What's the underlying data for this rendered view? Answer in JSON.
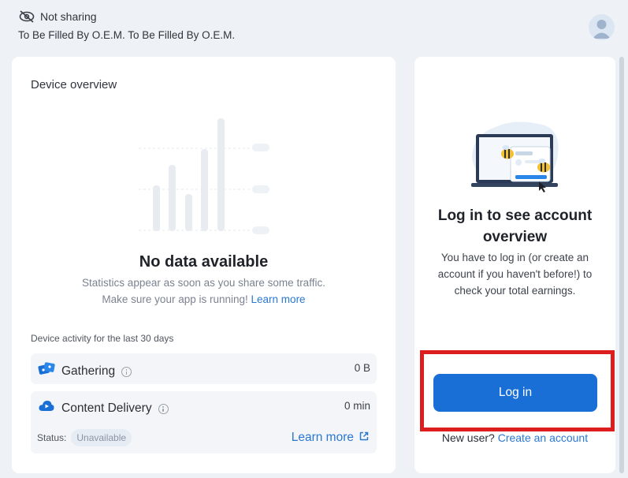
{
  "header": {
    "sharing_status": "Not sharing",
    "device_name": "To Be Filled By O.E.M. To Be Filled By O.E.M."
  },
  "overview": {
    "title": "Device overview",
    "no_data_title": "No data available",
    "no_data_line1": "Statistics appear as soon as you share some traffic.",
    "no_data_line2": "Make sure your app is running!",
    "learn_more": "Learn more",
    "activity_label": "Device activity for the last 30 days",
    "gathering_label": "Gathering",
    "gathering_value": "0 B",
    "content_delivery_label": "Content Delivery",
    "content_delivery_value": "0 min",
    "status_label": "Status:",
    "status_value": "Unavailable",
    "learn_more_link": "Learn more"
  },
  "account": {
    "title": "Log in to see account overview",
    "description": "You have to log in (or create an account if you haven't before!) to check your total earnings.",
    "login_button": "Log in",
    "new_user_label": "New user?",
    "create_account": "Create an account"
  },
  "colors": {
    "accent": "#1a6fd6",
    "link": "#2a78d0",
    "highlight_border": "#dd1e1e",
    "background": "#eef1f5"
  }
}
